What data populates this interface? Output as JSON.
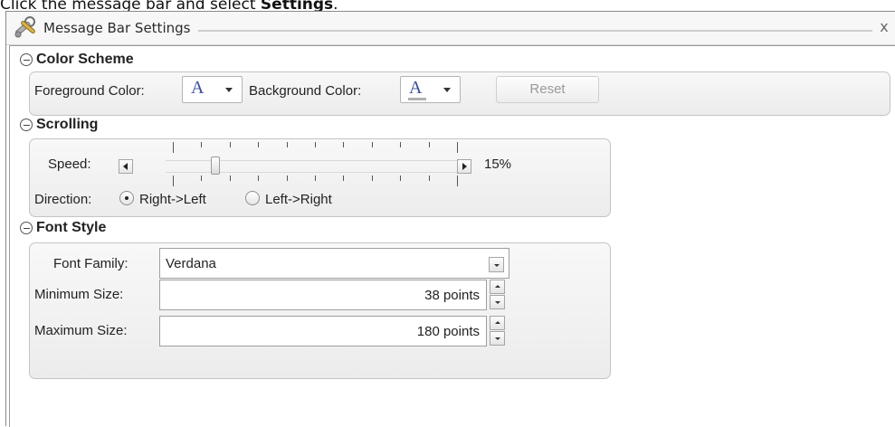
{
  "instruction": {
    "prefix": "Click the message bar and select ",
    "bold": "Settings",
    "suffix": "."
  },
  "dialog": {
    "title": "Message Bar Settings",
    "close_label": "x"
  },
  "color_scheme": {
    "heading": "Color Scheme",
    "foreground_label": "Foreground Color:",
    "foreground_glyph": "A",
    "background_label": "Background Color:",
    "background_glyph": "A",
    "reset_label": "Reset",
    "glyph_color": "#3a4d9a"
  },
  "scrolling": {
    "heading": "Scrolling",
    "speed_label": "Speed:",
    "speed_value": "15%",
    "speed_percent": 15,
    "direction_label": "Direction:",
    "options": [
      {
        "label": "Right->Left",
        "checked": true
      },
      {
        "label": "Left->Right",
        "checked": false
      }
    ]
  },
  "font_style": {
    "heading": "Font Style",
    "family_label": "Font Family:",
    "family_value": "Verdana",
    "min_label": "Minimum Size:",
    "min_value": "38 points",
    "max_label": "Maximum Size:",
    "max_value": "180 points"
  }
}
